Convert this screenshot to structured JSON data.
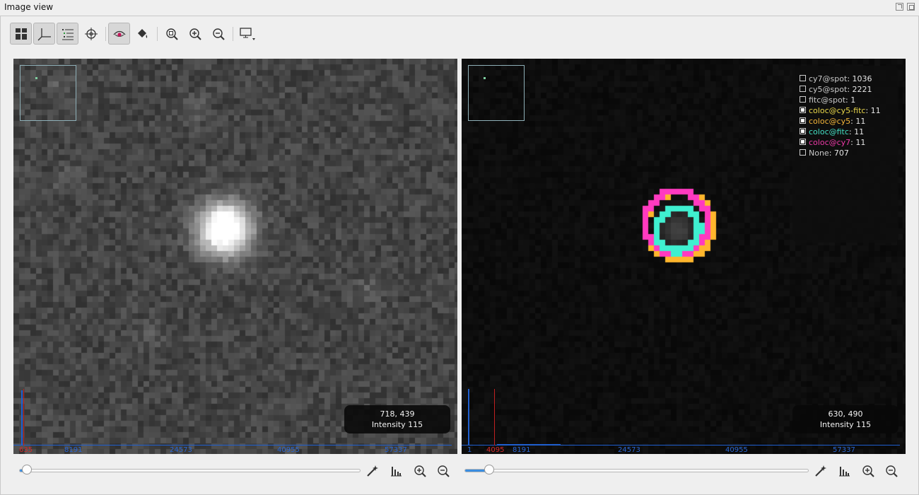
{
  "window": {
    "title": "Image view"
  },
  "toolbar": {
    "buttons": [
      {
        "name": "layout-grid-icon"
      },
      {
        "name": "axes-icon"
      },
      {
        "name": "list-icon"
      },
      {
        "name": "crosshair-icon"
      },
      {
        "name": "eye-icon"
      },
      {
        "name": "paint-bucket-icon"
      },
      {
        "name": "zoom-fit-icon"
      },
      {
        "name": "zoom-in-icon"
      },
      {
        "name": "zoom-out-icon"
      },
      {
        "name": "monitor-icon"
      }
    ]
  },
  "left_view": {
    "info_coords": "718, 439",
    "info_intensity": "Intensity 115",
    "hist_labels": [
      "635",
      "8191",
      "24573",
      "40955",
      "57337"
    ]
  },
  "right_view": {
    "info_coords": "630, 490",
    "info_intensity": "Intensity 115",
    "hist_labels": [
      "1",
      "4095",
      "8191",
      "24573",
      "40955",
      "57337"
    ],
    "legend": [
      {
        "name": "cy7@spot",
        "value": ": 1036",
        "checked": false,
        "color": "#c8c8c8"
      },
      {
        "name": "cy5@spot",
        "value": ": 2221",
        "checked": false,
        "color": "#c8c8c8"
      },
      {
        "name": "fitc@spot",
        "value": ": 1",
        "checked": false,
        "color": "#c8c8c8"
      },
      {
        "name": "coloc@cy5-fitc",
        "value": ": 11",
        "checked": true,
        "color": "#e8d64a"
      },
      {
        "name": "coloc@cy5",
        "value": ": 11",
        "checked": true,
        "color": "#f5b63a"
      },
      {
        "name": "coloc@fitc",
        "value": ": 11",
        "checked": true,
        "color": "#44e0c4"
      },
      {
        "name": "coloc@cy7",
        "value": ": 11",
        "checked": true,
        "color": "#ee3aa8"
      },
      {
        "name": "None",
        "value": ": 707",
        "checked": false,
        "color": "#c8c8c8"
      }
    ]
  },
  "sliders": {
    "left_level": 0.02,
    "right_level": 0.07
  },
  "colors": {
    "accent": "#3a8de0",
    "magenta": "#ff3ac0",
    "orange": "#ffb62c",
    "cyan": "#3ff0d0"
  }
}
